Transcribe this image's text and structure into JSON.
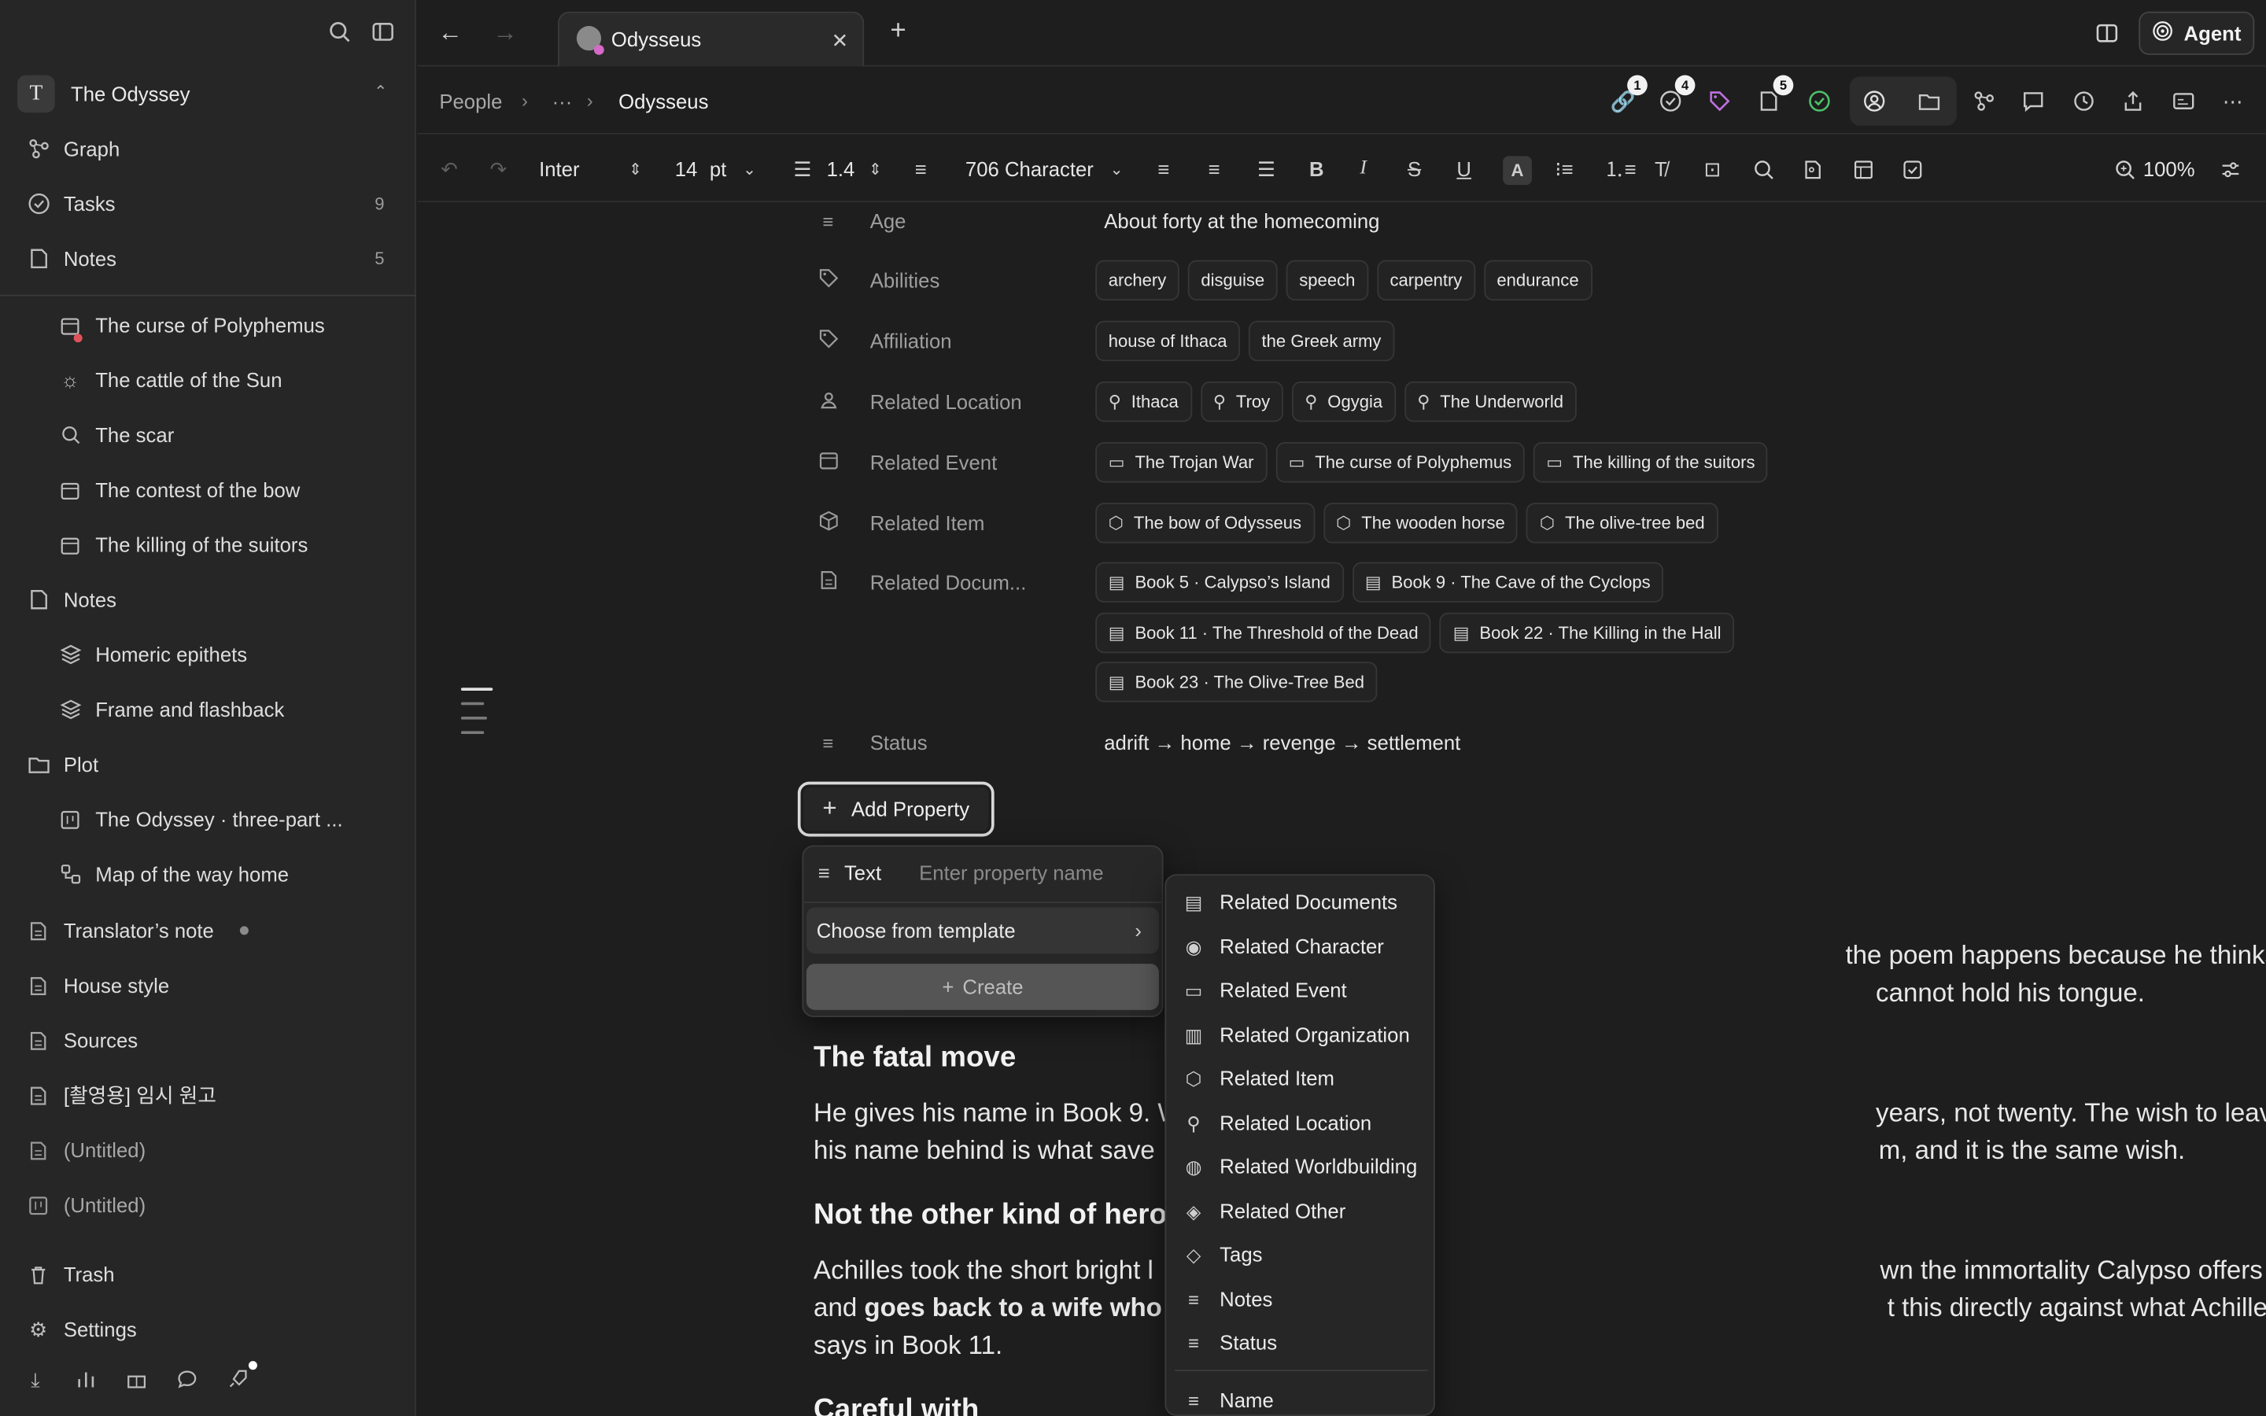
{
  "sidebar": {
    "workspace": {
      "initial": "T",
      "name": "The Odyssey"
    },
    "top_nav": [
      {
        "label": "Graph",
        "icon": "graph-icon",
        "count": ""
      },
      {
        "label": "Tasks",
        "icon": "tasks-icon",
        "count": "9"
      },
      {
        "label": "Notes",
        "icon": "notes-icon",
        "count": "5"
      }
    ],
    "tree": [
      {
        "label": "The curse of Polyphemus",
        "icon": "calendar-icon",
        "level": 1
      },
      {
        "label": "The cattle of the Sun",
        "icon": "sun-icon",
        "level": 1
      },
      {
        "label": "The scar",
        "icon": "search-icon",
        "level": 1
      },
      {
        "label": "The contest of the bow",
        "icon": "calendar-icon",
        "level": 1
      },
      {
        "label": "The killing of the suitors",
        "icon": "calendar-icon",
        "level": 1
      },
      {
        "label": "Notes",
        "icon": "notes-icon",
        "level": 0
      },
      {
        "label": "Homeric epithets",
        "icon": "layers-icon",
        "level": 1
      },
      {
        "label": "Frame and flashback",
        "icon": "layers-icon",
        "level": 1
      },
      {
        "label": "Plot",
        "icon": "folder-icon",
        "level": 0
      },
      {
        "label": "The Odyssey · three-part ...",
        "icon": "board-icon",
        "level": 1
      },
      {
        "label": "Map of the way home",
        "icon": "map-icon",
        "level": 1
      },
      {
        "label": "Translator’s note",
        "icon": "document-icon",
        "level": 0
      },
      {
        "label": "House style",
        "icon": "document-icon",
        "level": 0
      },
      {
        "label": "Sources",
        "icon": "document-icon",
        "level": 0
      },
      {
        "label": "[촬영용] 임시 원고",
        "icon": "document-icon",
        "level": 0
      },
      {
        "label": "(Untitled)",
        "icon": "document-icon",
        "level": 0
      },
      {
        "label": "(Untitled)",
        "icon": "board-icon",
        "level": 0
      }
    ],
    "trash": "Trash",
    "settings": "Settings"
  },
  "tab": {
    "title": "Odysseus"
  },
  "agent_label": "Agent",
  "breadcrumb": {
    "root": "People",
    "ellipsis": "···",
    "current": "Odysseus"
  },
  "badges": {
    "links": "1",
    "tasks": "4",
    "notes": "5"
  },
  "toolbar": {
    "font": "Inter",
    "size": "14",
    "size_unit": "pt",
    "line_height": "1.4",
    "char_count": "706 Character",
    "zoom": "100%"
  },
  "properties": {
    "age": {
      "label": "Age",
      "value": "About forty at the homecoming"
    },
    "abilities": {
      "label": "Abilities",
      "chips": [
        "archery",
        "disguise",
        "speech",
        "carpentry",
        "endurance"
      ]
    },
    "affiliation": {
      "label": "Affiliation",
      "chips": [
        "house of Ithaca",
        "the Greek army"
      ]
    },
    "location": {
      "label": "Related Location",
      "chips": [
        "Ithaca",
        "Troy",
        "Ogygia",
        "The Underworld"
      ]
    },
    "event": {
      "label": "Related Event",
      "chips": [
        "The Trojan War",
        "The curse of Polyphemus",
        "The killing of the suitors"
      ]
    },
    "item": {
      "label": "Related Item",
      "chips": [
        "The bow of Odysseus",
        "The wooden horse",
        "The olive-tree bed"
      ]
    },
    "documents": {
      "label": "Related Docum...",
      "chips_row1": [
        "Book 5 · Calypso’s Island",
        "Book 9 · The Cave of the Cyclops"
      ],
      "chips_row2": [
        "Book 11 · The Threshold of the Dead",
        "Book 22 · The Killing in the Hall"
      ],
      "chips_row3": [
        "Book 23 · The Olive-Tree Bed"
      ]
    },
    "status": {
      "label": "Status",
      "value": "adrift → home → revenge → settlement"
    }
  },
  "add_property": "Add Property",
  "popover": {
    "type_label": "Text",
    "name_placeholder": "Enter property name",
    "choose_template": "Choose from template",
    "create": "Create"
  },
  "template_menu": [
    {
      "label": "Related Documents",
      "icon": "document-icon"
    },
    {
      "label": "Related Character",
      "icon": "person-icon"
    },
    {
      "label": "Related Event",
      "icon": "calendar-icon"
    },
    {
      "label": "Related Organization",
      "icon": "building-icon"
    },
    {
      "label": "Related Item",
      "icon": "cube-icon"
    },
    {
      "label": "Related Location",
      "icon": "location-icon"
    },
    {
      "label": "Related Worldbuilding",
      "icon": "globe-icon"
    },
    {
      "label": "Related Other",
      "icon": "layers-icon"
    },
    {
      "label": "Tags",
      "icon": "tag-icon"
    },
    {
      "label": "Notes",
      "icon": "lines-icon"
    },
    {
      "label": "Status",
      "icon": "lines-icon"
    },
    {
      "label": "Name",
      "icon": "lines-icon"
    }
  ],
  "document": {
    "p1_line1": "the poem happens because he thinks",
    "p1_line2": "cannot hold his tongue.",
    "h1": "The fatal move",
    "p2_line1a": "He gives his name in Book 9. W",
    "p2_line1b": "years, not twenty. The wish to leave",
    "p2_line2a": "his name behind is what save",
    "p2_line2b": "m, and it is the same wish.",
    "h2": "Not the other kind of hero",
    "p3_line1a": "Achilles took the short bright l",
    "p3_line1b": "wn the immortality Calypso offers",
    "p3_line2a": "and ",
    "p3_line2bold": "goes back to a wife who",
    "p3_line2b": "t this directly against what Achilles",
    "p3_line3": "says in Book 11.",
    "h3": "Careful with"
  }
}
